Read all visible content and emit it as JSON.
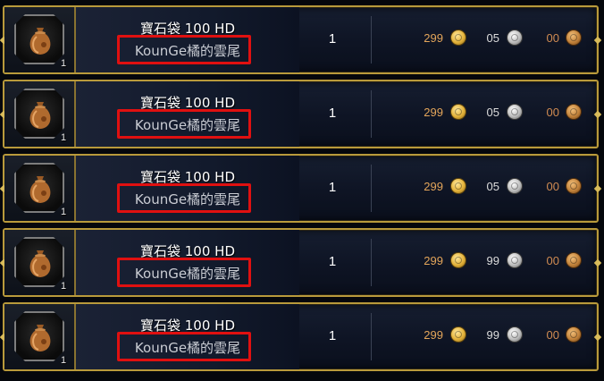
{
  "listings": [
    {
      "item_name": "寶石袋 100 HD",
      "seller": "KounGe橘的雲尾",
      "stack_count": "1",
      "count": "1",
      "price": {
        "gold": "299",
        "silver": "05",
        "copper": "00"
      }
    },
    {
      "item_name": "寶石袋 100 HD",
      "seller": "KounGe橘的雲尾",
      "stack_count": "1",
      "count": "1",
      "price": {
        "gold": "299",
        "silver": "05",
        "copper": "00"
      }
    },
    {
      "item_name": "寶石袋 100 HD",
      "seller": "KounGe橘的雲尾",
      "stack_count": "1",
      "count": "1",
      "price": {
        "gold": "299",
        "silver": "05",
        "copper": "00"
      }
    },
    {
      "item_name": "寶石袋 100 HD",
      "seller": "KounGe橘的雲尾",
      "stack_count": "1",
      "count": "1",
      "price": {
        "gold": "299",
        "silver": "99",
        "copper": "00"
      }
    },
    {
      "item_name": "寶石袋 100 HD",
      "seller": "KounGe橘的雲尾",
      "stack_count": "1",
      "count": "1",
      "price": {
        "gold": "299",
        "silver": "99",
        "copper": "00"
      }
    }
  ],
  "icons": {
    "item": "gem-bag-icon",
    "gold": "gold-coin-icon",
    "silver": "silver-coin-icon",
    "copper": "copper-coin-icon"
  },
  "colors": {
    "frame_border": "#b99a3b",
    "highlight": "#e01010",
    "gold_text": "#e3a55a",
    "silver_text": "#dcdcdc",
    "copper_text": "#d08b52"
  }
}
